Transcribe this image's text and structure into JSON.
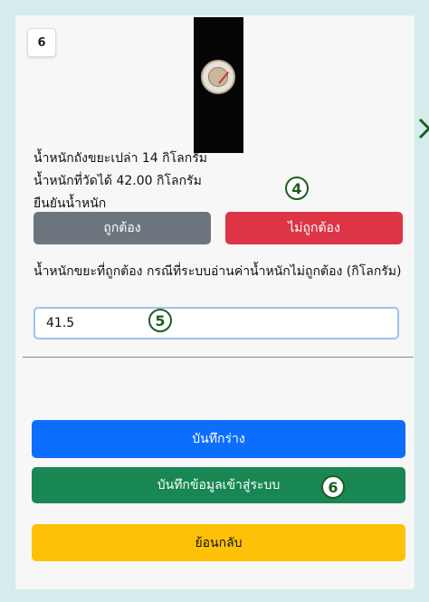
{
  "photo_number": "6",
  "info": {
    "bin_weight": "น้ำหนักถังขยะเปล่า 14 กิโลกรัม",
    "measured_weight": "น้ำหนักที่วัดได้ 42.00 กิโลกรัม",
    "confirm_prompt": "ยืนยันน้ำหนัก"
  },
  "buttons": {
    "correct": "ถูกต้อง",
    "incorrect": "ไม่ถูกต้อง",
    "save_draft": "บันทึกร่าง",
    "submit": "บันทึกข้อมูลเข้าสู่ระบบ",
    "back": "ย้อนกลับ"
  },
  "correction": {
    "label": "น้ำหนักขยะที่ถูกต้อง กรณีที่ระบบอ่านค่าน้ำหนักไม่ถูกต้อง (กิโลกรัม)",
    "value": "41.5"
  },
  "markers": {
    "m4": "4",
    "m5": "5",
    "m6": "6"
  },
  "colors": {
    "correct_button": "#6c757d",
    "incorrect_button": "#dc3545",
    "save_draft_button": "#0d6efd",
    "submit_button": "#198754",
    "back_button": "#ffc107",
    "marker": "#1b5e20"
  },
  "icons": {
    "gauge": "scale-dial-photo",
    "edge_arrow": "chevron-right-icon"
  }
}
